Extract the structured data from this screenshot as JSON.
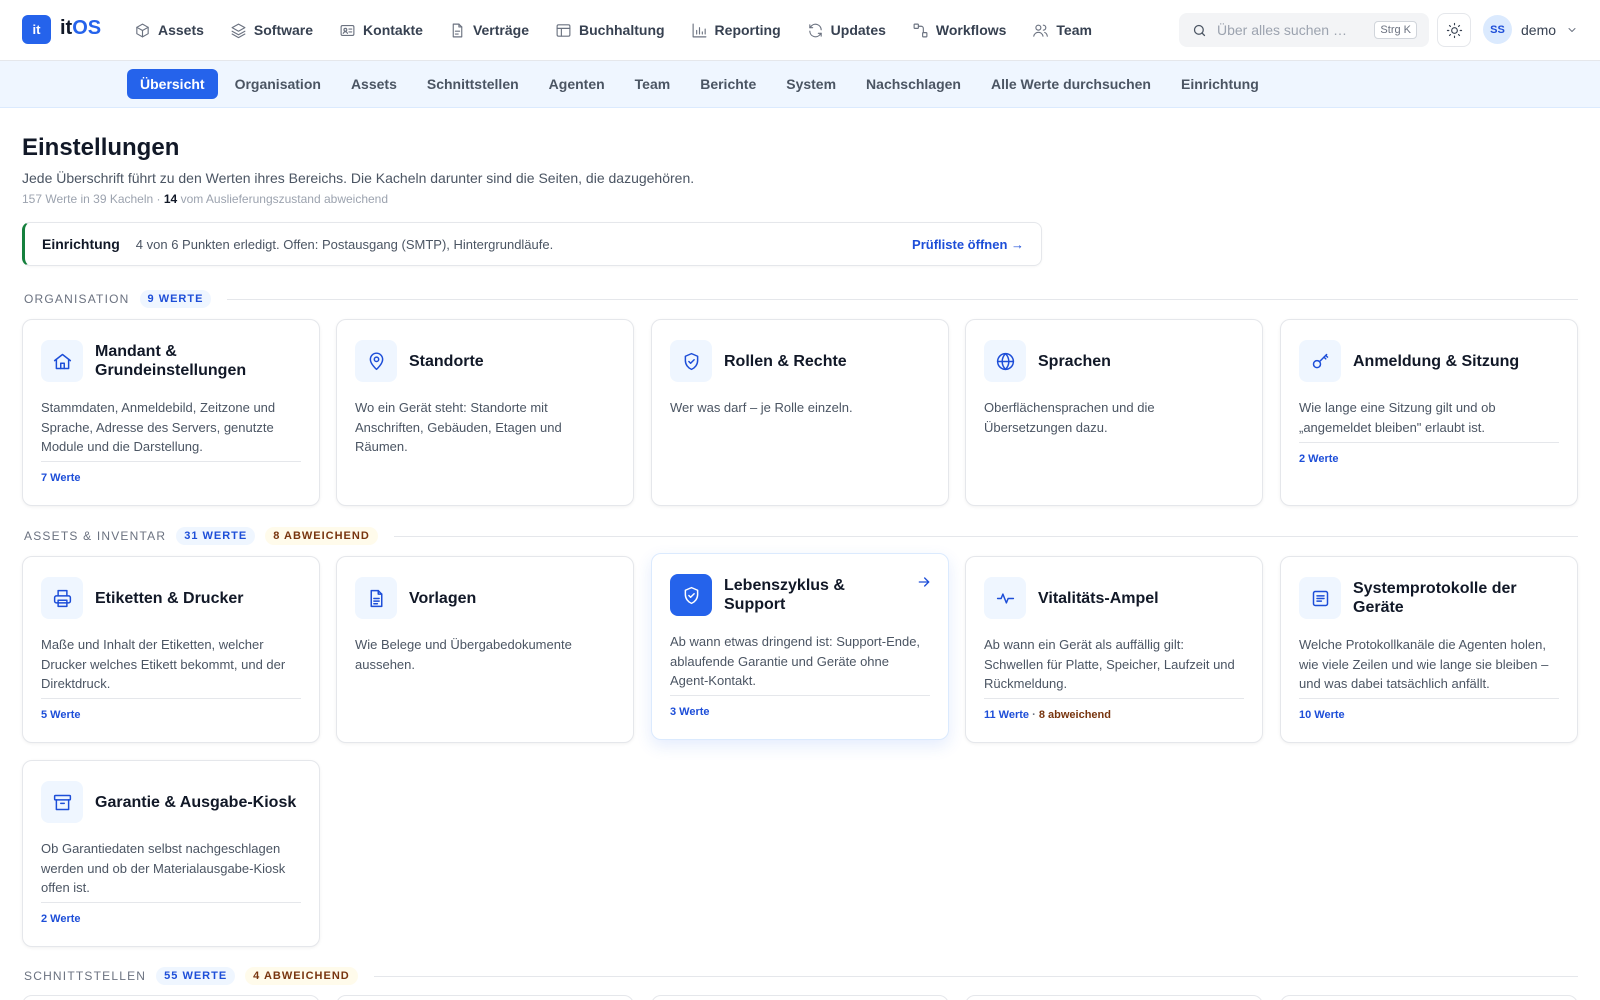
{
  "app": {
    "logo_mark": "it",
    "logo_it": "it",
    "logo_os": "OS"
  },
  "main_nav": [
    {
      "label": "Assets",
      "icon": "cube-icon"
    },
    {
      "label": "Software",
      "icon": "layers-icon"
    },
    {
      "label": "Kontakte",
      "icon": "contact-card-icon"
    },
    {
      "label": "Verträge",
      "icon": "document-icon"
    },
    {
      "label": "Buchhaltung",
      "icon": "table-icon"
    },
    {
      "label": "Reporting",
      "icon": "bar-chart-icon"
    },
    {
      "label": "Updates",
      "icon": "refresh-icon"
    },
    {
      "label": "Workflows",
      "icon": "workflow-icon"
    },
    {
      "label": "Team",
      "icon": "users-icon"
    }
  ],
  "search": {
    "placeholder": "Über alles suchen …",
    "shortcut": "Strg K"
  },
  "user": {
    "initials": "SS",
    "name": "demo"
  },
  "sub_nav": {
    "items": [
      "Übersicht",
      "Organisation",
      "Assets",
      "Schnittstellen",
      "Agenten",
      "Team",
      "Berichte",
      "System",
      "Nachschlagen",
      "Alle Werte durchsuchen",
      "Einrichtung"
    ],
    "active": "Übersicht"
  },
  "page": {
    "title": "Einstellungen",
    "description": "Jede Überschrift führt zu den Werten ihres Bereichs. Die Kacheln darunter sind die Seiten, die dazugehören.",
    "meta_prefix": "157 Werte in 39 Kacheln · ",
    "meta_count": "14",
    "meta_suffix": " vom Auslieferungszustand abweichend"
  },
  "banner": {
    "title": "Einrichtung",
    "text": "4 von 6 Punkten erledigt. Offen: Postausgang (SMTP), Hintergrundläufe.",
    "link": "Prüfliste öffnen →",
    "accent": "#15803d"
  },
  "sections": {
    "organisation": {
      "title": "ORGANISATION",
      "badge": "9 WERTE",
      "cards": [
        {
          "title": "Mandant & Grundeinstellungen",
          "icon": "home-icon",
          "description": "Stammdaten, Anmeldebild, Zeitzone und Sprache, Adresse des Servers, genutzte Module und die Darstellung.",
          "footer": "7 Werte"
        },
        {
          "title": "Standorte",
          "icon": "map-pin-icon",
          "description": "Wo ein Gerät steht: Standorte mit Anschriften, Gebäuden, Etagen und Räumen."
        },
        {
          "title": "Rollen & Rechte",
          "icon": "shield-check-icon",
          "description": "Wer was darf – je Rolle einzeln."
        },
        {
          "title": "Sprachen",
          "icon": "globe-icon",
          "description": "Oberflächensprachen und die Übersetzungen dazu."
        },
        {
          "title": "Anmeldung & Sitzung",
          "icon": "key-icon",
          "description": "Wie lange eine Sitzung gilt und ob „angemeldet bleiben\" erlaubt ist.",
          "footer": "2 Werte"
        }
      ]
    },
    "assets": {
      "title": "ASSETS & INVENTAR",
      "badge": "31 WERTE",
      "badge_diff": "8 ABWEICHEND",
      "cards": [
        {
          "title": "Etiketten & Drucker",
          "icon": "printer-icon",
          "description": "Maße und Inhalt der Etiketten, welcher Drucker welches Etikett bekommt, und der Direktdruck.",
          "footer": "5 Werte"
        },
        {
          "title": "Vorlagen",
          "icon": "file-text-icon",
          "description": "Wie Belege und Übergabedokumente aussehen."
        },
        {
          "title": "Lebenszyklus & Support",
          "icon": "shield-check-icon",
          "description": "Ab wann etwas dringend ist: Support-Ende, ablaufende Garantie und Geräte ohne Agent-Kontakt.",
          "footer": "3 Werte"
        },
        {
          "title": "Vitalitäts-Ampel",
          "icon": "pulse-icon",
          "description": "Ab wann ein Gerät als auffällig gilt: Schwellen für Platte, Speicher, Laufzeit und Rückmeldung.",
          "footer": "11 Werte",
          "footer_sep": " · ",
          "footer_diff": "8 abweichend"
        },
        {
          "title": "Systemprotokolle der Geräte",
          "icon": "log-list-icon",
          "description": "Welche Protokollkanäle die Agenten holen, wie viele Zeilen und wie lange sie bleiben – und was dabei tatsächlich anfällt.",
          "footer": "10 Werte"
        },
        {
          "title": "Garantie & Ausgabe-Kiosk",
          "icon": "archive-icon",
          "description": "Ob Garantiedaten selbst nachgeschlagen werden und ob der Materialausgabe-Kiosk offen ist.",
          "footer": "2 Werte"
        }
      ]
    },
    "schnittstellen": {
      "title": "SCHNITTSTELLEN",
      "badge": "55 WERTE",
      "badge_diff": "4 ABWEICHEND"
    }
  },
  "colors": {
    "primary": "#2563eb",
    "primary_dark": "#1d4ed8",
    "subnav_bg": "#eff6ff",
    "amber_text": "#78350f"
  }
}
